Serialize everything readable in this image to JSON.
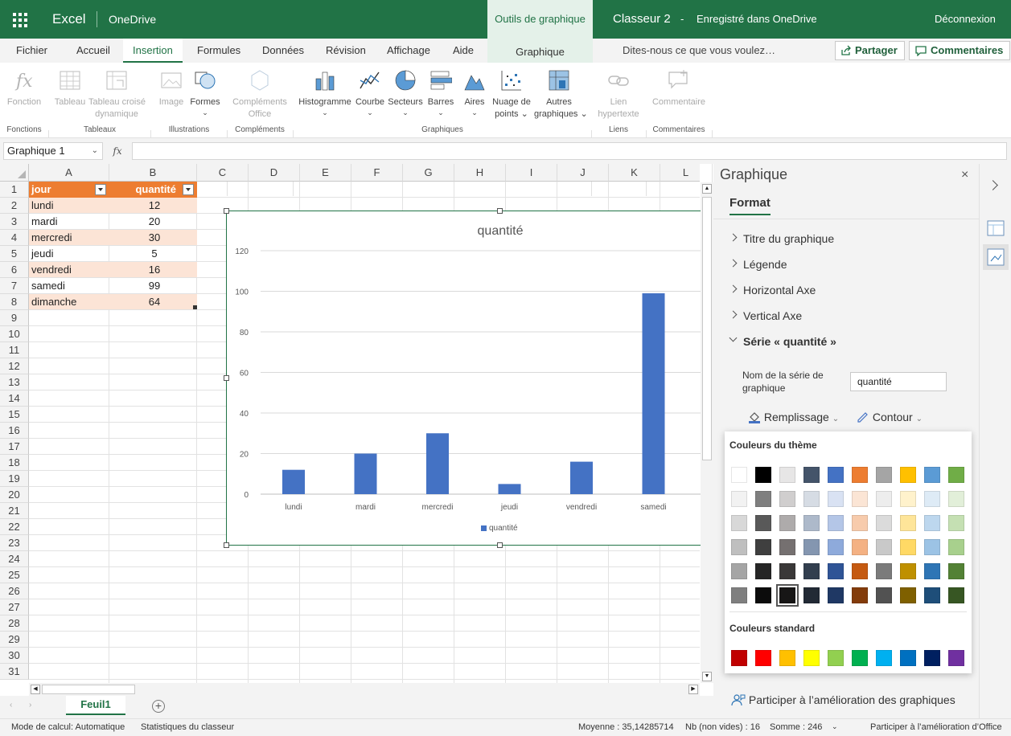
{
  "app": {
    "name": "Excel",
    "service": "OneDrive",
    "context_tab": "Outils de graphique",
    "context_subtab": "Graphique",
    "doc_title": "Classeur 2",
    "save_status": "Enregistré dans OneDrive",
    "signout": "Déconnexion"
  },
  "tabs": [
    "Fichier",
    "Accueil",
    "Insertion",
    "Formules",
    "Données",
    "Révision",
    "Affichage",
    "Aide"
  ],
  "active_tab": "Insertion",
  "tellme": "Dites-nous ce que vous voulez…",
  "share": "Partager",
  "comments_btn": "Commentaires",
  "ribbon": {
    "fonction": "Fonction",
    "tableau": "Tableau",
    "tcd1": "Tableau croisé",
    "tcd2": "dynamique",
    "image": "Image",
    "formes": "Formes",
    "comp1": "Compléments",
    "comp2": "Office",
    "histogramme": "Histogramme",
    "courbe": "Courbe",
    "secteurs": "Secteurs",
    "barres": "Barres",
    "aires": "Aires",
    "nuage1": "Nuage de",
    "nuage2": "points",
    "autres1": "Autres",
    "autres2": "graphiques",
    "lien1": "Lien",
    "lien2": "hypertexte",
    "commentaire": "Commentaire",
    "groups": {
      "fonctions": "Fonctions",
      "tableaux": "Tableaux",
      "illustrations": "Illustrations",
      "complements": "Compléments",
      "graphiques": "Graphiques",
      "liens": "Liens",
      "commentaires": "Commentaires"
    }
  },
  "namebox": "Graphique 1",
  "fx": "fx",
  "columns": [
    "A",
    "B",
    "C",
    "D",
    "E",
    "F",
    "G",
    "H",
    "I",
    "J",
    "K",
    "L"
  ],
  "rows": [
    "1",
    "2",
    "3",
    "4",
    "5",
    "6",
    "7",
    "8",
    "9",
    "10",
    "11",
    "12",
    "13",
    "14",
    "15",
    "16",
    "17",
    "18",
    "19",
    "20",
    "21",
    "22",
    "23",
    "24",
    "25",
    "26",
    "27",
    "28",
    "29",
    "30",
    "31"
  ],
  "table": {
    "headers": [
      "jour",
      "quantité"
    ],
    "rows": [
      {
        "jour": "lundi",
        "q": "12"
      },
      {
        "jour": "mardi",
        "q": "20"
      },
      {
        "jour": "mercredi",
        "q": "30"
      },
      {
        "jour": "jeudi",
        "q": "5"
      },
      {
        "jour": "vendredi",
        "q": "16"
      },
      {
        "jour": "samedi",
        "q": "99"
      },
      {
        "jour": "dimanche",
        "q": "64"
      }
    ]
  },
  "chart_data": {
    "type": "bar",
    "title": "quantité",
    "categories": [
      "lundi",
      "mardi",
      "mercredi",
      "jeudi",
      "vendredi",
      "samedi"
    ],
    "series": [
      {
        "name": "quantité",
        "values": [
          12,
          20,
          30,
          5,
          16,
          99
        ],
        "color": "#4472c4"
      }
    ],
    "yticks": [
      "0",
      "20",
      "40",
      "60",
      "80",
      "100",
      "120"
    ],
    "ylim": [
      0,
      120
    ],
    "grid": true,
    "legend": "bottom"
  },
  "pane": {
    "title": "Graphique",
    "tab": "Format",
    "sections": [
      "Titre du graphique",
      "Légende",
      "Horizontal Axe",
      "Vertical Axe"
    ],
    "open_section": "Série « quantité »",
    "series_name_label1": "Nom de la série de",
    "series_name_label2": "graphique",
    "series_name_value": "quantité",
    "fill": "Remplissage",
    "outline": "Contour",
    "theme_colors_label": "Couleurs du thème",
    "standard_colors_label": "Couleurs standard",
    "feedback": "Participer à l’amélioration des graphiques"
  },
  "theme_colors": [
    [
      "#ffffff",
      "#000000",
      "#e7e6e6",
      "#44546a",
      "#4472c4",
      "#ed7d31",
      "#a5a5a5",
      "#ffc000",
      "#5b9bd5",
      "#70ad47"
    ],
    [
      "#f2f2f2",
      "#7f7f7f",
      "#d0cece",
      "#d6dce4",
      "#d9e2f3",
      "#fbe5d5",
      "#ededed",
      "#fff2cc",
      "#deebf6",
      "#e2efd9"
    ],
    [
      "#d8d8d8",
      "#595959",
      "#aeabab",
      "#adb9ca",
      "#b4c6e7",
      "#f7cbac",
      "#dbdbdb",
      "#fee599",
      "#bdd7ee",
      "#c5e0b3"
    ],
    [
      "#bfbfbf",
      "#3f3f3f",
      "#757070",
      "#8496b0",
      "#8eaadb",
      "#f4b183",
      "#c9c9c9",
      "#ffd965",
      "#9cc3e5",
      "#a8d08d"
    ],
    [
      "#a5a5a5",
      "#262626",
      "#3a3838",
      "#323f4f",
      "#2f5496",
      "#c55a11",
      "#7b7b7b",
      "#bf9000",
      "#2e75b5",
      "#538135"
    ],
    [
      "#7f7f7f",
      "#0c0c0c",
      "#171616",
      "#222a35",
      "#1f3864",
      "#833c0b",
      "#525252",
      "#7f6000",
      "#1e4e79",
      "#375623"
    ]
  ],
  "standard_colors": [
    "#c00000",
    "#ff0000",
    "#ffc000",
    "#ffff00",
    "#92d050",
    "#00b050",
    "#00b0f0",
    "#0070c0",
    "#002060",
    "#7030a0"
  ],
  "sheet_tab": "Feuil1",
  "status": {
    "mode": "Mode de calcul: Automatique",
    "stats": "Statistiques du classeur",
    "avg": "Moyenne : 35,14285714",
    "count": "Nb (non vides) : 16",
    "sum": "Somme : 246",
    "improve": "Participer à l’amélioration d’Office"
  }
}
